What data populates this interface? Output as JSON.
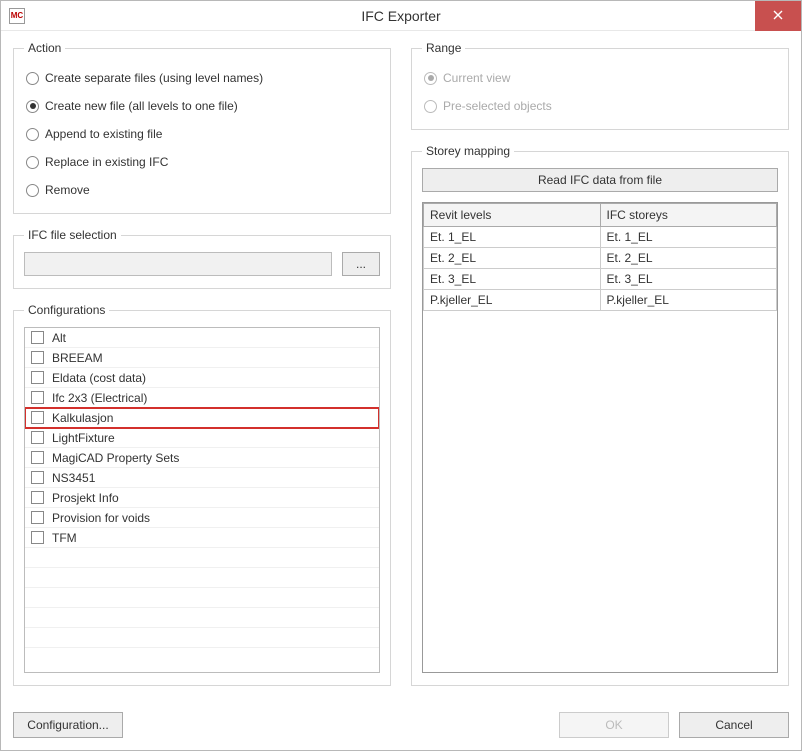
{
  "window": {
    "title": "IFC Exporter"
  },
  "action": {
    "legend": "Action",
    "options": [
      {
        "label": "Create separate files (using level names)",
        "selected": false
      },
      {
        "label": "Create new file (all levels to one file)",
        "selected": true
      },
      {
        "label": "Append to existing file",
        "selected": false
      },
      {
        "label": "Replace in existing IFC",
        "selected": false
      },
      {
        "label": "Remove",
        "selected": false
      }
    ]
  },
  "file_selection": {
    "legend": "IFC file selection",
    "browse_label": "..."
  },
  "configurations": {
    "legend": "Configurations",
    "items": [
      {
        "label": "Alt",
        "checked": false,
        "highlight": false
      },
      {
        "label": "BREEAM",
        "checked": false,
        "highlight": false
      },
      {
        "label": "Eldata (cost data)",
        "checked": false,
        "highlight": false
      },
      {
        "label": "Ifc 2x3 (Electrical)",
        "checked": false,
        "highlight": false
      },
      {
        "label": "Kalkulasjon",
        "checked": false,
        "highlight": true
      },
      {
        "label": "LightFixture",
        "checked": false,
        "highlight": false
      },
      {
        "label": "MagiCAD Property Sets",
        "checked": false,
        "highlight": false
      },
      {
        "label": "NS3451",
        "checked": false,
        "highlight": false
      },
      {
        "label": "Prosjekt Info",
        "checked": false,
        "highlight": false
      },
      {
        "label": "Provision for voids",
        "checked": false,
        "highlight": false
      },
      {
        "label": "TFM",
        "checked": false,
        "highlight": false
      }
    ]
  },
  "range": {
    "legend": "Range",
    "options": [
      {
        "label": "Current view",
        "selected": true,
        "disabled": true
      },
      {
        "label": "Pre-selected objects",
        "selected": false,
        "disabled": true
      }
    ]
  },
  "storey": {
    "legend": "Storey mapping",
    "read_button": "Read IFC data from file",
    "headers": {
      "revit": "Revit levels",
      "ifc": "IFC storeys"
    },
    "rows": [
      {
        "revit": "Et. 1_EL",
        "ifc": "Et. 1_EL"
      },
      {
        "revit": "Et. 2_EL",
        "ifc": "Et. 2_EL"
      },
      {
        "revit": "Et. 3_EL",
        "ifc": "Et. 3_EL"
      },
      {
        "revit": "P.kjeller_EL",
        "ifc": "P.kjeller_EL"
      }
    ]
  },
  "footer": {
    "configuration": "Configuration...",
    "ok": "OK",
    "cancel": "Cancel"
  }
}
